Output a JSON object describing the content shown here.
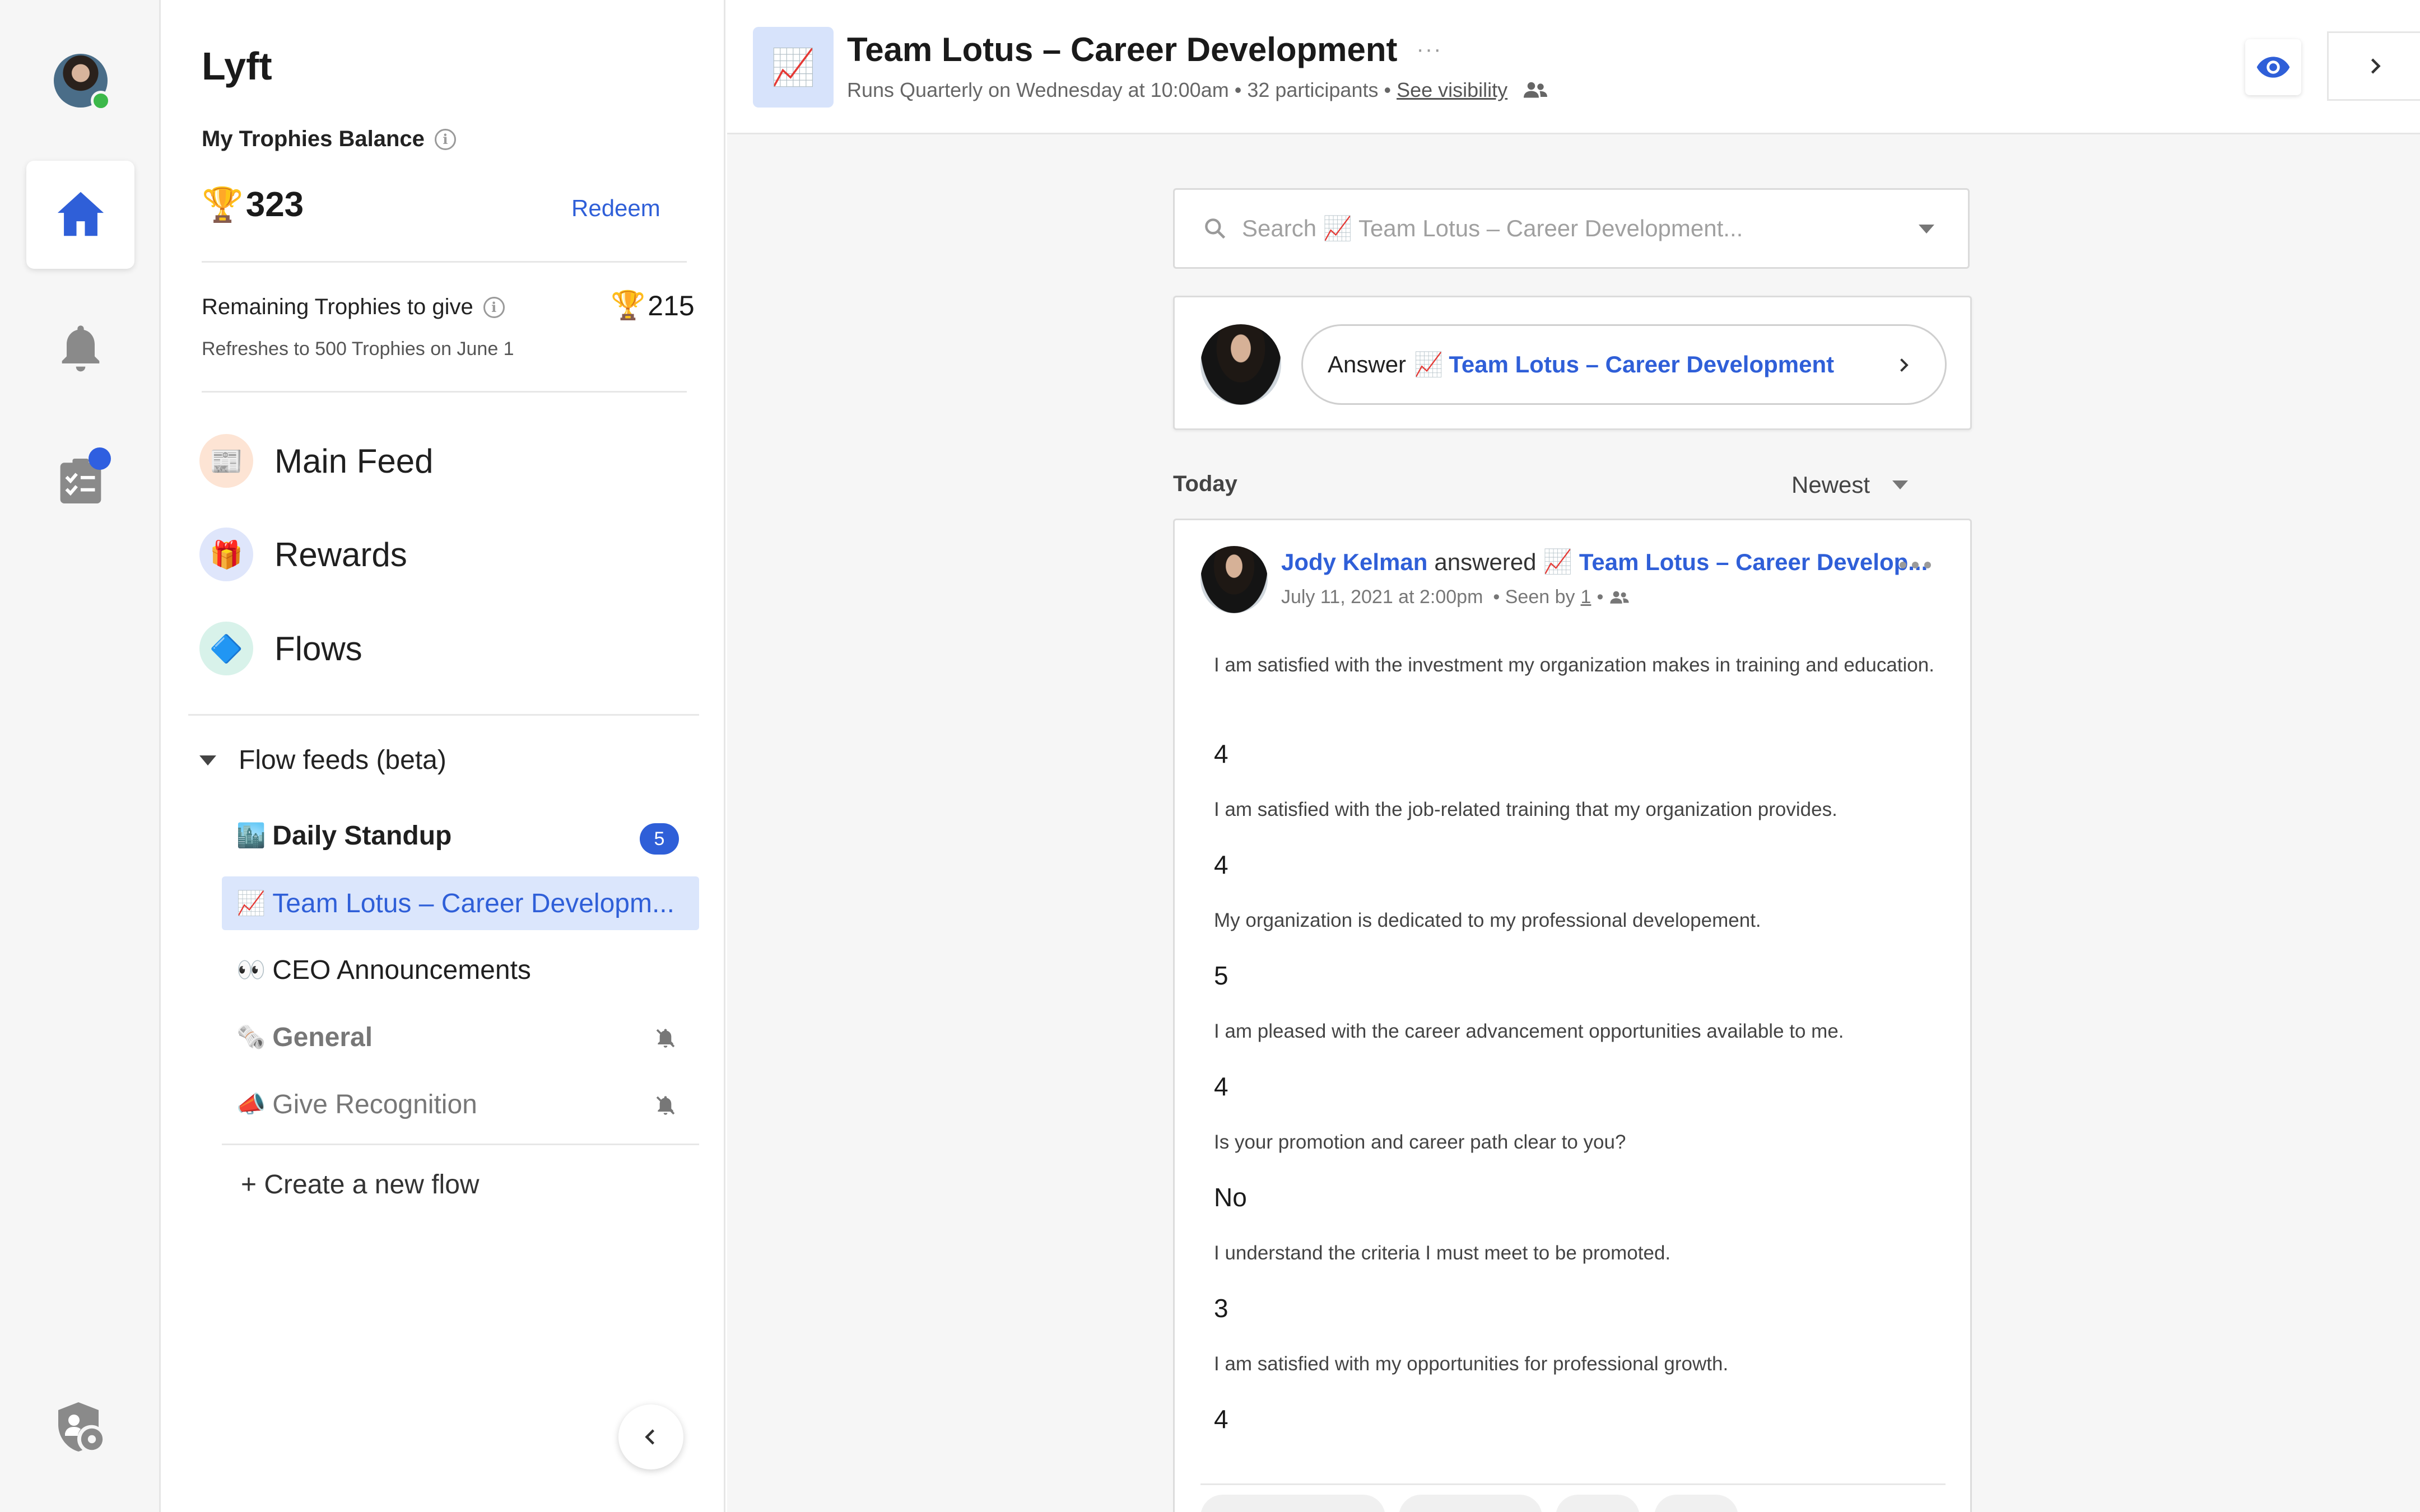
{
  "rail": {
    "icons": [
      "avatar",
      "home-icon",
      "bell-icon",
      "tasks-icon",
      "admin-icon"
    ]
  },
  "sidebar": {
    "brand": "Lyft",
    "balance_label": "My Trophies Balance",
    "balance_value": "323",
    "redeem_label": "Redeem",
    "remaining_label": "Remaining Trophies to give",
    "remaining_value": "215",
    "refresh_note": "Refreshes to 500 Trophies on June 1",
    "nav": [
      {
        "label": "Main Feed",
        "icon": "newspaper-icon"
      },
      {
        "label": "Rewards",
        "icon": "gift-icon"
      },
      {
        "label": "Flows",
        "icon": "flows-icon"
      }
    ],
    "flow_feeds_label": "Flow feeds (beta)",
    "flows": [
      {
        "emoji": "🏙️",
        "label": "Daily Standup",
        "badge": "5"
      },
      {
        "emoji": "📈",
        "label": "Team Lotus – Career Developm..."
      },
      {
        "emoji": "👀",
        "label": "CEO Announcements"
      },
      {
        "emoji": "🗞️",
        "label": "General"
      },
      {
        "emoji": "📣",
        "label": "Give Recognition"
      }
    ],
    "create_flow_label": "+ Create a new flow"
  },
  "header": {
    "icon_emoji": "📈",
    "title": "Team Lotus – Career Development",
    "title_menu": "···",
    "schedule": "Runs Quarterly on Wednesday at 10:00am",
    "participants": "32 participants",
    "separator": "•",
    "visibility_link": "See visibility"
  },
  "search": {
    "placeholder": "Search 📈 Team Lotus – Career Development..."
  },
  "answer": {
    "prefix": "Answer",
    "emoji": "📈",
    "flow_name": "Team Lotus – Career Development"
  },
  "feed": {
    "today_label": "Today",
    "sort_label": "Newest"
  },
  "post": {
    "author": "Jody Kelman",
    "verb": "answered",
    "emoji": "📈",
    "flow_name": "Team Lotus – Career Develop...",
    "date": "July 11, 2021 at 2:00pm",
    "seen_prefix": "• Seen by",
    "seen_count": "1",
    "seen_suffix": "•",
    "responses": [
      {
        "q": "I am satisfied with the investment my organization makes in training and education.",
        "a": "4"
      },
      {
        "q": "I am satisfied with the job-related training that my organization provides.",
        "a": "4"
      },
      {
        "q": "My organization is dedicated to my professional developement.",
        "a": "5"
      },
      {
        "q": "I am pleased with the career advancement opportunities available to me.",
        "a": "4"
      },
      {
        "q": "Is your promotion and career path clear to you?",
        "a": "No"
      },
      {
        "q": "I understand the criteria I must meet to be promoted.",
        "a": "3"
      },
      {
        "q": "I am satisfied with my opportunities for professional growth.",
        "a": "4"
      }
    ]
  },
  "colors": {
    "accent": "#2f5fd8",
    "active_bg": "#dbe6fc",
    "online": "#3cb84a"
  }
}
